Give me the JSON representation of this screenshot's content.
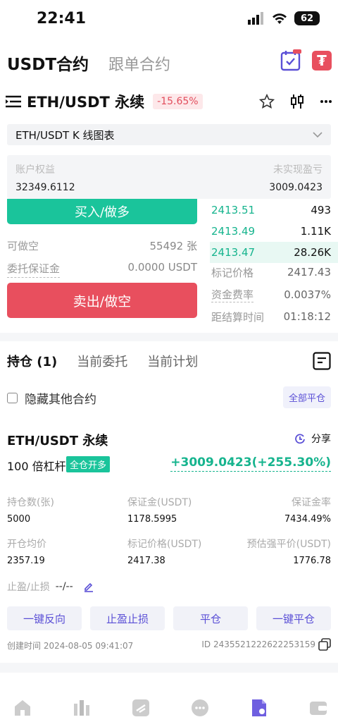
{
  "status": {
    "time": "22:41",
    "battery": "62"
  },
  "tabs": {
    "active": "USDT合约",
    "other": "跟单合约"
  },
  "pair": {
    "title": "ETH/USDT 永续",
    "change": "-15.65%"
  },
  "kline_select": {
    "label": "ETH/USDT K 线图表"
  },
  "account": {
    "equity_label": "账户权益",
    "equity_value": "32349.6112",
    "upnl_label": "未实现盈亏",
    "upnl_value": "3009.0423"
  },
  "trade": {
    "buy_label": "买入/做多",
    "sell_label": "卖出/做空",
    "available_label": "可做空",
    "available_value": "55492 张",
    "margin_label": "委托保证金",
    "margin_value": "0.0000 USDT"
  },
  "orderbook": [
    {
      "price": "2413.51",
      "qty": "493"
    },
    {
      "price": "2413.49",
      "qty": "1.11K"
    },
    {
      "price": "2413.47",
      "qty": "28.26K"
    }
  ],
  "market_info": {
    "mark_label": "标记价格",
    "mark_value": "2417.43",
    "funding_label": "资金费率",
    "funding_value": "0.0037%",
    "settle_label": "距结算时间",
    "settle_value": "01:18:12"
  },
  "position_tabs": [
    "持仓 (1)",
    "当前委托",
    "当前计划"
  ],
  "hide_others": {
    "label": "隐藏其他合约",
    "close_all": "全部平仓"
  },
  "position": {
    "title": "ETH/USDT 永续",
    "share": "分享",
    "leverage": "100 倍杠杆",
    "mode_badge": "全仓开多",
    "pnl": "+3009.0423(+255.30%)",
    "fields": {
      "qty_label": "持仓数(张)",
      "qty_value": "5000",
      "margin_label": "保证金(USDT)",
      "margin_value": "1178.5995",
      "margin_rate_label": "保证金率",
      "margin_rate_value": "7434.49%",
      "entry_label": "开仓均价",
      "entry_value": "2357.19",
      "mark_label": "标记价格(USDT)",
      "mark_value": "2417.38",
      "liq_label": "预估强平价(USDT)",
      "liq_value": "1776.78"
    },
    "tpsl_label": "止盈/止损",
    "tpsl_value": "--/--",
    "actions": [
      "一键反向",
      "止盈止损",
      "平仓",
      "一键平仓"
    ],
    "created": "创建时间 2024-08-05 09:41:07",
    "id": "ID 2435521222622253159"
  },
  "colors": {
    "green": "#1ac49b",
    "red": "#e84f5e",
    "purple": "#6f5fe0"
  },
  "bottom_nav": [
    "home-icon",
    "markets-icon",
    "trade-icon",
    "chat-icon",
    "contract-icon",
    "wallet-icon"
  ]
}
